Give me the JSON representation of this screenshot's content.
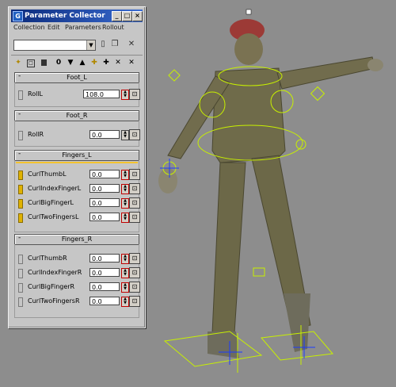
{
  "window": {
    "title": "Parameter Collector",
    "app_icon": "3ds-max-icon",
    "controls": [
      "minimize",
      "restore",
      "close"
    ]
  },
  "menu": [
    "Collection",
    "Edit",
    "Parameters",
    "Rollout"
  ],
  "toolbar": {
    "collection_value": "",
    "tool_icons": [
      "new-collection-icon",
      "duplicate-icon",
      "delete-icon"
    ]
  },
  "actions": {
    "icons": [
      "select-multiple-icon",
      "isolate-icon",
      "collapse-icon"
    ],
    "count": "0",
    "more_icons": [
      "move-down-icon",
      "move-up-icon",
      "add-selected-icon",
      "add-icon",
      "remove-icon",
      "remove-all-icon"
    ]
  },
  "rollouts": [
    {
      "title": "Foot_L",
      "params": [
        {
          "label": "RollL",
          "value": "108.0",
          "selected": false
        }
      ]
    },
    {
      "title": "Foot_R",
      "params": [
        {
          "label": "RollR",
          "value": "0.0",
          "selected": false
        }
      ]
    },
    {
      "title": "Fingers_L",
      "params": [
        {
          "label": "CurlThumbL",
          "value": "0.0",
          "selected": true
        },
        {
          "label": "CurlIndexFingerL",
          "value": "0.0",
          "selected": true
        },
        {
          "label": "CurlBigFingerL",
          "value": "0.0",
          "selected": true
        },
        {
          "label": "CurlTwoFingersL",
          "value": "0.0",
          "selected": true
        }
      ]
    },
    {
      "title": "Fingers_R",
      "params": [
        {
          "label": "CurlThumbR",
          "value": "0.0",
          "selected": false
        },
        {
          "label": "CurlIndexFingerR",
          "value": "0.0",
          "selected": false
        },
        {
          "label": "CurlBigFingerR",
          "value": "0.0",
          "selected": false
        },
        {
          "label": "CurlTwoFingersR",
          "value": "0.0",
          "selected": false
        }
      ]
    }
  ],
  "colors": {
    "background": "#8d8d8d",
    "panel": "#c6c6c6",
    "title_bar": "#0a2a7a",
    "highlight": "#f4c430",
    "rig": "#c8f000",
    "figure": "#6f6b4a"
  }
}
